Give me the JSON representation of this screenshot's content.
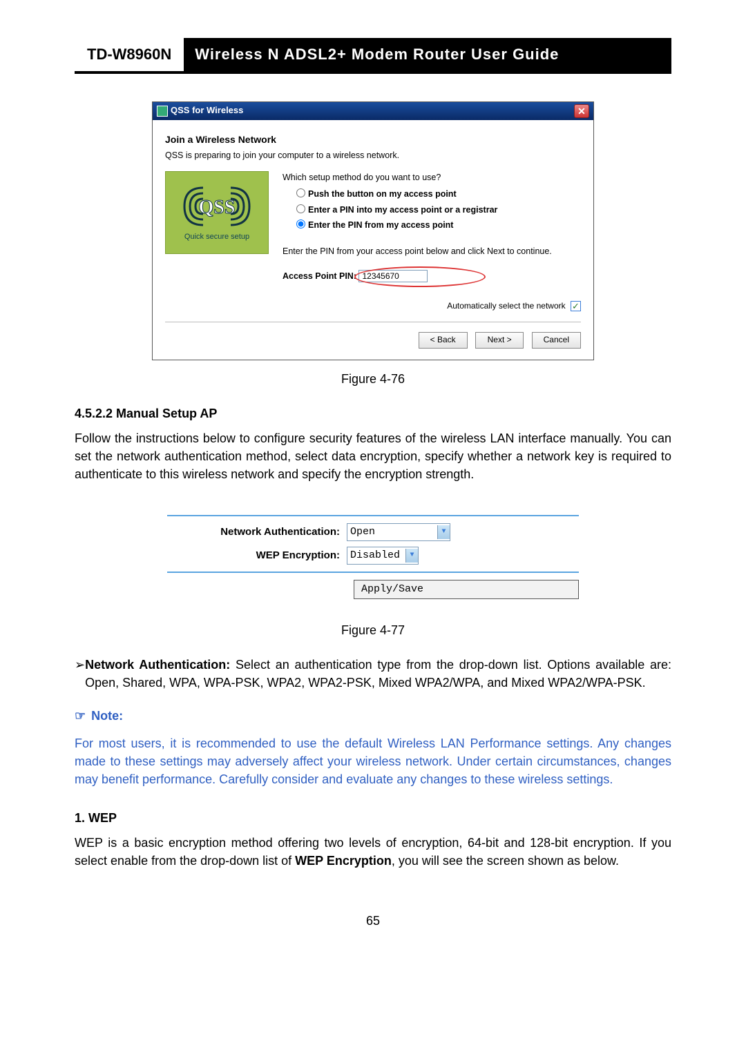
{
  "header": {
    "model": "TD-W8960N",
    "title": "Wireless  N  ADSL2+  Modem  Router  User  Guide"
  },
  "fig476": {
    "caption": "Figure 4-76",
    "window_title": "QSS for Wireless",
    "heading": "Join a Wireless Network",
    "intro": "QSS is preparing to join your computer to a wireless network.",
    "qss_sub": "Quick secure setup",
    "question": "Which setup method do you want to use?",
    "opt1": "Push the button on my access point",
    "opt2": "Enter a PIN into my access point or a registrar",
    "opt3": "Enter the PIN from my access point",
    "pin_prompt": "Enter the PIN from your access point below and click Next to continue.",
    "pin_label": "Access Point PIN:",
    "pin_value": "12345670",
    "auto": "Automatically select the network",
    "back": "< Back",
    "next": "Next >",
    "cancel": "Cancel"
  },
  "section": {
    "num": "4.5.2.2   Manual Setup AP",
    "para": "Follow the instructions below to configure security features of the wireless LAN interface manually. You can set the network authentication method, select data encryption, specify whether a network key is required to authenticate to this wireless network and specify the encryption strength."
  },
  "fig477": {
    "caption": "Figure 4-77",
    "auth_label": "Network Authentication:",
    "auth_value": "Open",
    "wep_label": "WEP Encryption:",
    "wep_value": "Disabled",
    "btn": "Apply/Save"
  },
  "bullet": {
    "lead": "Network Authentication:",
    "text": " Select an authentication type from the drop-down list. Options available are: Open, Shared, WPA, WPA-PSK, WPA2, WPA2-PSK, Mixed WPA2/WPA, and Mixed WPA2/WPA-PSK."
  },
  "note": {
    "head": "Note:",
    "text": "For most users, it is recommended to use the default Wireless LAN Performance settings. Any changes made to these settings may adversely affect your wireless network. Under certain circumstances, changes may benefit performance. Carefully consider and evaluate any changes to these wireless settings."
  },
  "wep": {
    "head": "1.    WEP",
    "text_pre": "WEP is a basic encryption method offering two levels of encryption, 64-bit and 128-bit encryption. If you select enable from the drop-down list of ",
    "text_bold": "WEP Encryption",
    "text_post": ", you will see the screen shown as below."
  },
  "page_number": "65"
}
